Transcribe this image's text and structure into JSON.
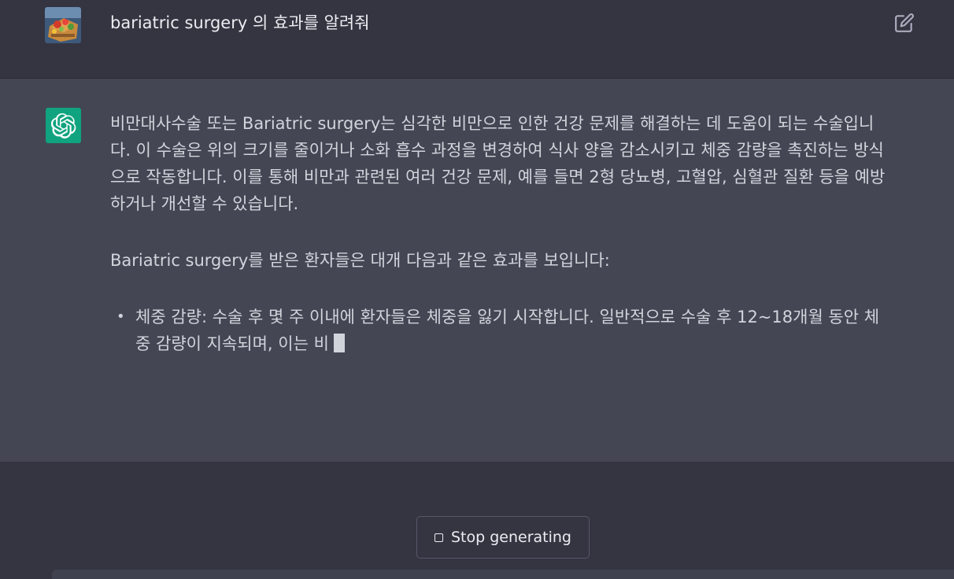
{
  "conversation": {
    "user_message": "bariatric surgery 의 효과를 알려줘",
    "assistant": {
      "paragraph_1": "비만대사수술 또는 Bariatric surgery는 심각한 비만으로 인한 건강 문제를 해결하는 데 도움이 되는 수술입니다. 이 수술은 위의 크기를 줄이거나 소화 흡수 과정을 변경하여 식사 양을 감소시키고 체중 감량을 촉진하는 방식으로 작동합니다. 이를 통해 비만과 관련된 여러 건강 문제, 예를 들면 2형 당뇨병, 고혈압, 심혈관 질환 등을 예방하거나 개선할 수 있습니다.",
      "paragraph_2": "Bariatric surgery를 받은 환자들은 대개 다음과 같은 효과를 보입니다:",
      "bullets": [
        "체중 감량: 수술 후 몇 주 이내에 환자들은 체중을 잃기 시작합니다. 일반적으로 수술 후 12~18개월 동안 체중 감량이 지속되며, 이는 비"
      ]
    }
  },
  "controls": {
    "stop_label": "Stop generating"
  },
  "icons": {
    "edit": "edit-icon",
    "assistant_logo": "openai-logo-icon",
    "stop": "stop-square-icon"
  },
  "colors": {
    "background": "#343541",
    "assistant_background": "#444654",
    "assistant_avatar": "#10a37f"
  }
}
